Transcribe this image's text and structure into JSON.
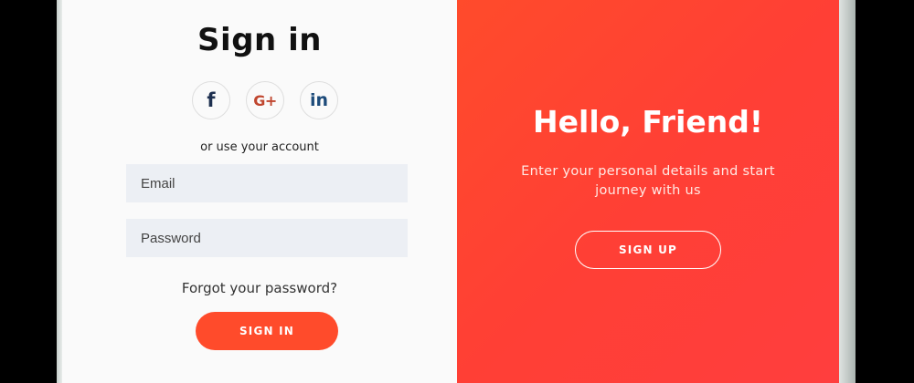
{
  "sign_in_panel": {
    "title": "Sign in",
    "social": [
      {
        "name": "facebook",
        "glyph": "f"
      },
      {
        "name": "google-plus",
        "glyph": "G+"
      },
      {
        "name": "linkedin",
        "glyph": "in"
      }
    ],
    "alt_text": "or use your account",
    "email": {
      "placeholder": "Email",
      "value": ""
    },
    "password": {
      "placeholder": "Password",
      "value": ""
    },
    "forgot_label": "Forgot your password?",
    "submit_label": "SIGN IN"
  },
  "overlay_panel": {
    "title": "Hello, Friend!",
    "subtitle": "Enter your personal details and start journey with us",
    "button_label": "SIGN UP"
  },
  "colors": {
    "accent": "#ff4b2b",
    "input_bg": "#eceff4",
    "panel_bg": "#fafafa"
  },
  "icons": {
    "facebook": "facebook-icon",
    "google_plus": "google-plus-icon",
    "linkedin": "linkedin-icon"
  }
}
